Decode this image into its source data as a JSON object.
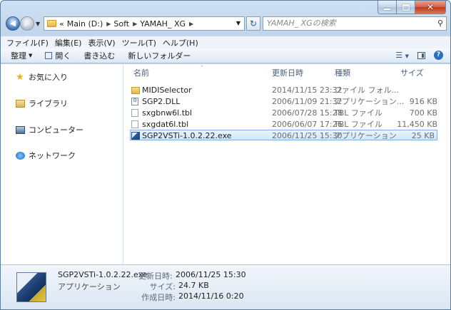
{
  "window": {
    "caption_buttons": {
      "minimize": "minimize-icon",
      "maximize": "maximize-icon",
      "close": "close-icon"
    }
  },
  "address": {
    "crumbs": [
      "«",
      "Main (D:)",
      "Soft",
      "YAMAH_ XG"
    ]
  },
  "search": {
    "placeholder": "YAMAH_ XGの検索"
  },
  "menubar": [
    "ファイル(F)",
    "編集(E)",
    "表示(V)",
    "ツール(T)",
    "ヘルプ(H)"
  ],
  "toolbar": {
    "organize": "整理",
    "open": "開く",
    "burn": "書き込む",
    "new_folder": "新しいフォルダー"
  },
  "navpane": {
    "favorites": "お気に入り",
    "libraries": "ライブラリ",
    "computer": "コンピューター",
    "network": "ネットワーク"
  },
  "columns": {
    "name": "名前",
    "date": "更新日時",
    "type": "種類",
    "size": "サイズ"
  },
  "files": [
    {
      "name": "MIDISelector",
      "date": "2014/11/15 23:32",
      "type": "ファイル フォル...",
      "size": "",
      "icon": "folder-icon"
    },
    {
      "name": "SGP2.DLL",
      "date": "2006/11/09 21:32",
      "type": "アプリケーション...",
      "size": "916 KB",
      "icon": "dll-file-icon"
    },
    {
      "name": "sxgbnw6l.tbl",
      "date": "2006/07/28 15:28",
      "type": "TBL ファイル",
      "size": "700 KB",
      "icon": "document-icon"
    },
    {
      "name": "sxgdat6l.tbl",
      "date": "2006/06/07 17:26",
      "type": "TBL ファイル",
      "size": "11,450 KB",
      "icon": "document-icon"
    },
    {
      "name": "SGP2VSTi-1.0.2.22.exe",
      "date": "2006/11/25 15:30",
      "type": "アプリケーション",
      "size": "25 KB",
      "icon": "exe-file-icon"
    }
  ],
  "details": {
    "name": "SGP2VSTi-1.0.2.22.exe",
    "type": "アプリケーション",
    "modified_label": "更新日時:",
    "modified_value": "2006/11/25 15:30",
    "size_label": "サイズ:",
    "size_value": "24.7 KB",
    "created_label": "作成日時:",
    "created_value": "2014/11/16 0:20"
  }
}
